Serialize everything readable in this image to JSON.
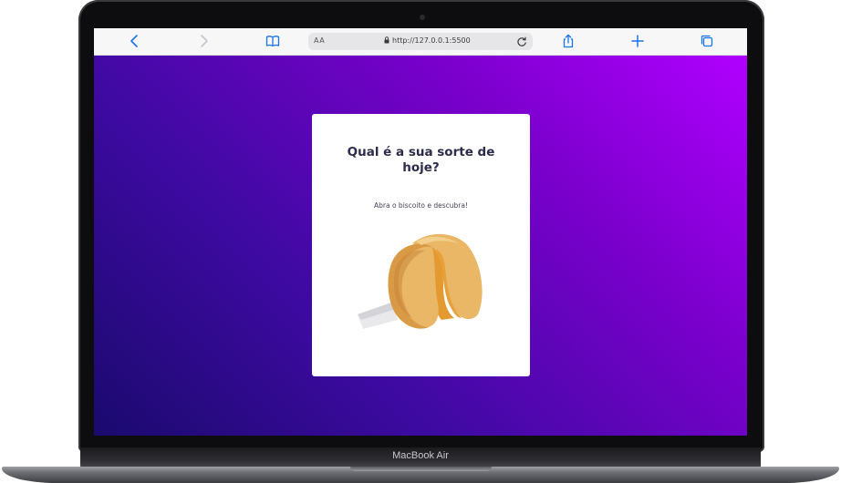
{
  "device": {
    "model_label": "MacBook Air"
  },
  "browser": {
    "text_size_label": "AA",
    "url": "http://127.0.0.1:5500",
    "icons": {
      "back": "chevron-left-icon",
      "forward": "chevron-right-icon",
      "bookmarks": "book-icon",
      "lock": "lock-icon",
      "reload": "reload-icon",
      "share": "share-icon",
      "new_tab": "plus-icon",
      "tabs": "tabs-icon"
    },
    "accent_color": "#1a73e8"
  },
  "page": {
    "gradient_colors": [
      "#1a0a6e",
      "#b000ff"
    ],
    "card": {
      "title": "Qual é a sua sorte de hoje?",
      "subtitle": "Abra o biscoito e descubra!",
      "image": "fortune-cookie-icon"
    }
  }
}
